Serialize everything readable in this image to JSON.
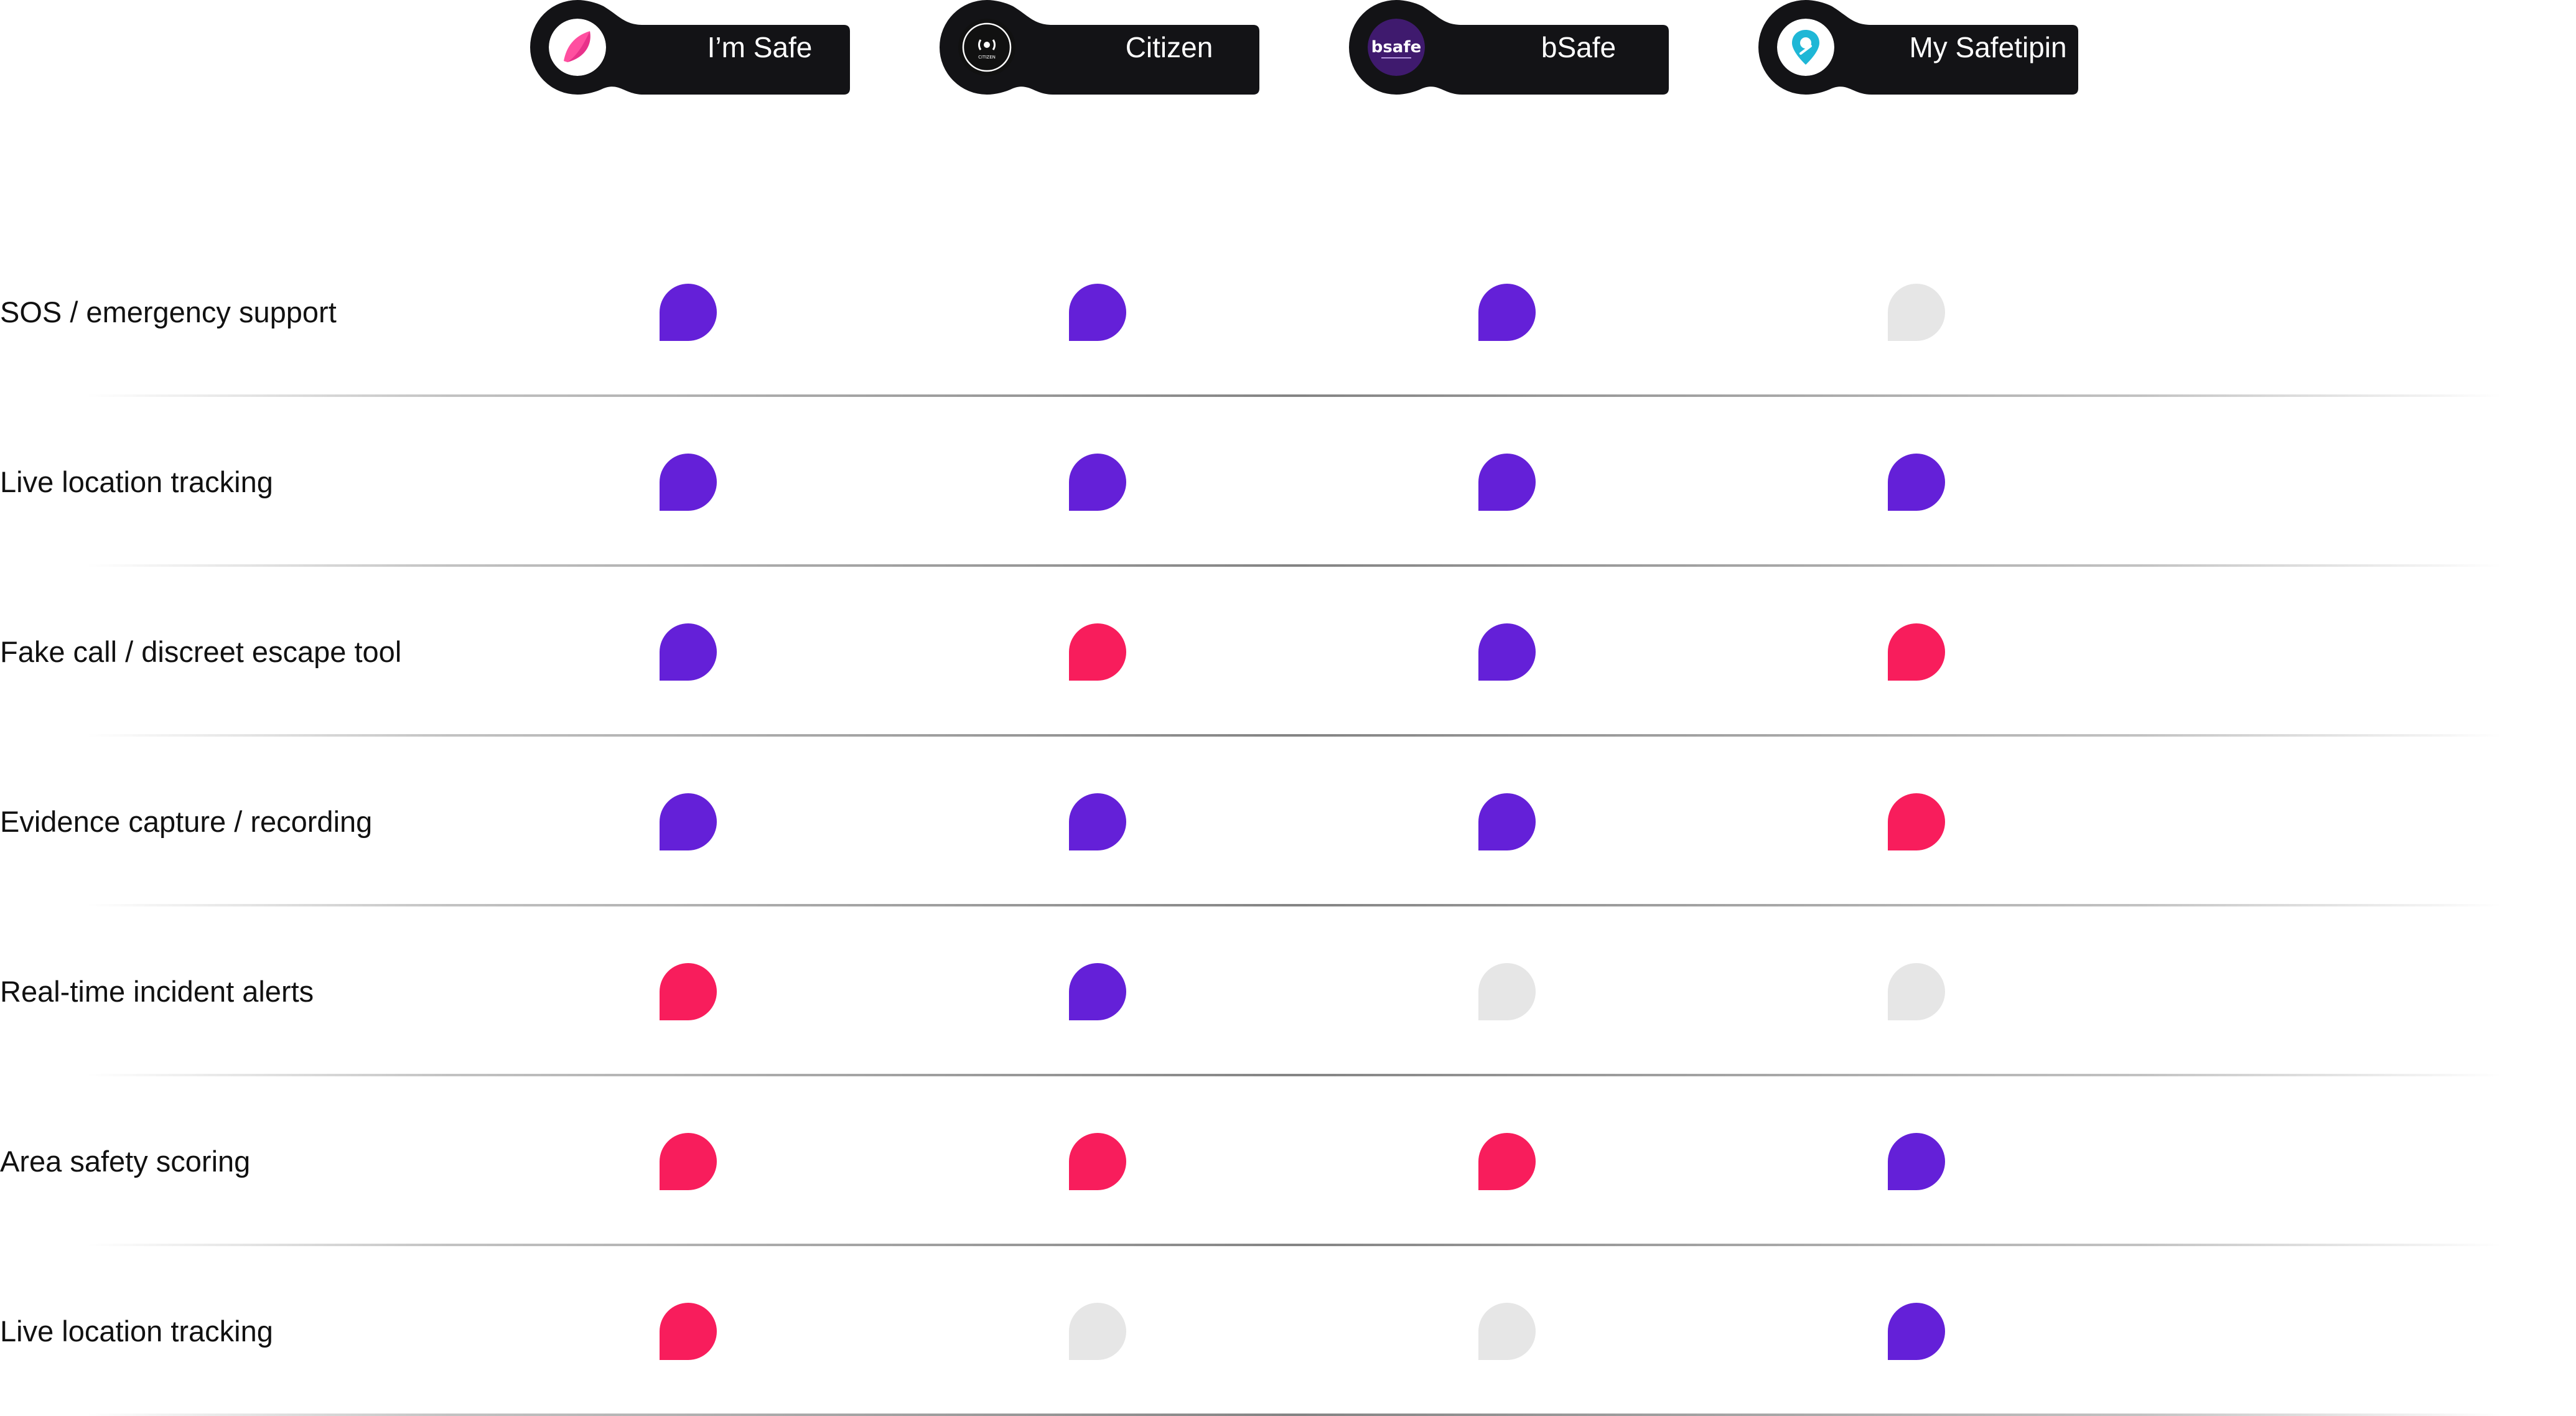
{
  "apps": [
    {
      "name": "I’m Safe",
      "logo": "imsafe-logo-icon",
      "logo_bg": "#ffffff",
      "logo_accent": "#ff4fa0"
    },
    {
      "name": "Citizen",
      "logo": "citizen-logo-icon",
      "logo_bg": "#111111",
      "logo_accent": "#ffffff",
      "logo_text": "CITIZEN"
    },
    {
      "name": "bSafe",
      "logo": "bsafe-logo-icon",
      "logo_bg": "#3f1a6e",
      "logo_accent": "#ffffff",
      "logo_text": "bsafe"
    },
    {
      "name": "My Safetipin",
      "logo": "safetipin-logo-icon",
      "logo_bg": "#ffffff",
      "logo_accent": "#1fb7d6"
    }
  ],
  "colors": {
    "full": "#6420d8",
    "partial": "#f81d5c",
    "none": "#e6e6e6",
    "tag_bg": "#131316"
  },
  "features": [
    {
      "label": "SOS / emergency support",
      "status": [
        "full",
        "full",
        "full",
        "none"
      ]
    },
    {
      "label": "Live location tracking",
      "status": [
        "full",
        "full",
        "full",
        "full"
      ]
    },
    {
      "label": "Fake call / discreet escape tool",
      "status": [
        "full",
        "partial",
        "full",
        "partial"
      ]
    },
    {
      "label": "Evidence capture / recording",
      "status": [
        "full",
        "full",
        "full",
        "partial"
      ]
    },
    {
      "label": "Real-time incident alerts",
      "status": [
        "partial",
        "full",
        "none",
        "none"
      ]
    },
    {
      "label": "Area safety scoring",
      "status": [
        "partial",
        "partial",
        "partial",
        "full"
      ]
    },
    {
      "label": "Live location tracking",
      "status": [
        "partial",
        "none",
        "none",
        "full"
      ]
    }
  ]
}
